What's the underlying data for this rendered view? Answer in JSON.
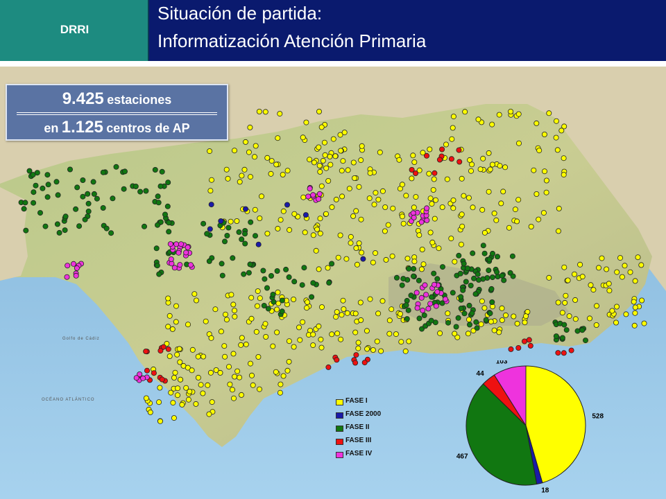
{
  "header": {
    "tag": "DRRI",
    "title_line1": "Situación de partida:",
    "title_line2": "Informatización Atención Primaria"
  },
  "stats": {
    "stations_number": "9.425",
    "stations_label": "estaciones",
    "centers_prefix": "en",
    "centers_number": "1.125",
    "centers_label": "centros de AP"
  },
  "map_labels": {
    "ocean": "OCÉANO ATLÁNTICO",
    "golfo": "Golfo de Cádiz"
  },
  "colors": {
    "fase_i": "#ffff00",
    "fase_2000": "#1a1aa8",
    "fase_ii": "#117711",
    "fase_iii": "#ee1111",
    "fase_iv": "#ee33dd"
  },
  "legend": [
    {
      "label": "FASE I",
      "color": "#ffff00"
    },
    {
      "label": "FASE 2000",
      "color": "#1a1aa8"
    },
    {
      "label": "FASE II",
      "color": "#117711"
    },
    {
      "label": "FASE III",
      "color": "#ee1111"
    },
    {
      "label": "FASE IV",
      "color": "#ee33dd"
    }
  ],
  "chart_data": {
    "type": "pie",
    "categories": [
      "FASE I",
      "FASE 2000",
      "FASE II",
      "FASE III",
      "FASE IV"
    ],
    "values": [
      528,
      18,
      467,
      44,
      103
    ],
    "value_labels": [
      "528",
      "18",
      "467",
      "44",
      "103"
    ],
    "colors": [
      "#ffff00",
      "#1a1aa8",
      "#117711",
      "#ee1111",
      "#ee33dd"
    ],
    "title": ""
  }
}
